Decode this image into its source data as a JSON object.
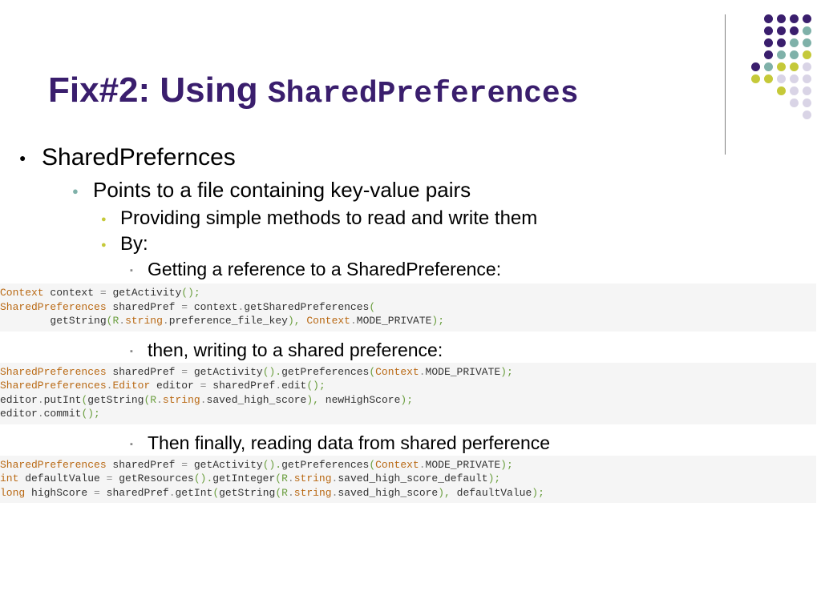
{
  "title": {
    "prefix": "Fix#2: Using ",
    "mono": "SharedPreferences"
  },
  "bullets": {
    "l1": "SharedPrefernces",
    "l2": "Points to a file containing key-value pairs",
    "l3a": "Providing simple methods to read and write them",
    "l3b": "By:",
    "l4a": "Getting a reference to a SharedPreference:",
    "l4b": "then, writing to a shared preference:",
    "l4c": "Then finally, reading data from shared perference"
  },
  "code": {
    "block1": {
      "line1": {
        "t1": "Context",
        "t2": " context ",
        "t3": "=",
        "t4": " getActivity",
        "t5": "();"
      },
      "line2": {
        "t1": "SharedPreferences",
        "t2": " sharedPref ",
        "t3": "=",
        "t4": " context",
        "t5": ".",
        "t6": "getSharedPreferences",
        "t7": "("
      },
      "line3": {
        "pad": "        ",
        "t1": "getString",
        "t2": "(",
        "t3": "R",
        "t4": ".",
        "t5": "string",
        "t6": ".",
        "t7": "preference_file_key",
        "t8": "),",
        "t9": " ",
        "t10": "Context",
        "t11": ".",
        "t12": "MODE_PRIVATE",
        "t13": ");"
      }
    },
    "block2": {
      "line1": {
        "t1": "SharedPreferences",
        "t2": " sharedPref ",
        "t3": "=",
        "t4": " getActivity",
        "t5": "().",
        "t6": "getPreferences",
        "t7": "(",
        "t8": "Context",
        "t9": ".",
        "t10": "MODE_PRIVATE",
        "t11": ");"
      },
      "line2": {
        "t1": "SharedPreferences",
        "t2": ".",
        "t3": "Editor",
        "t4": " editor ",
        "t5": "=",
        "t6": " sharedPref",
        "t7": ".",
        "t8": "edit",
        "t9": "();"
      },
      "line3": {
        "t1": "editor",
        "t2": ".",
        "t3": "putInt",
        "t4": "(",
        "t5": "getString",
        "t6": "(",
        "t7": "R",
        "t8": ".",
        "t9": "string",
        "t10": ".",
        "t11": "saved_high_score",
        "t12": "),",
        "t13": " newHighScore",
        "t14": ");"
      },
      "line4": {
        "t1": "editor",
        "t2": ".",
        "t3": "commit",
        "t4": "();"
      }
    },
    "block3": {
      "line1": {
        "t1": "SharedPreferences",
        "t2": " sharedPref ",
        "t3": "=",
        "t4": " getActivity",
        "t5": "().",
        "t6": "getPreferences",
        "t7": "(",
        "t8": "Context",
        "t9": ".",
        "t10": "MODE_PRIVATE",
        "t11": ");"
      },
      "line2": {
        "t1": "int",
        "t2": " defaultValue ",
        "t3": "=",
        "t4": " getResources",
        "t5": "().",
        "t6": "getInteger",
        "t7": "(",
        "t8": "R",
        "t9": ".",
        "t10": "string",
        "t11": ".",
        "t12": "saved_high_score_default",
        "t13": ");"
      },
      "line3": {
        "t1": "long",
        "t2": " highScore ",
        "t3": "=",
        "t4": " sharedPref",
        "t5": ".",
        "t6": "getInt",
        "t7": "(",
        "t8": "getString",
        "t9": "(",
        "t10": "R",
        "t11": ".",
        "t12": "string",
        "t13": ".",
        "t14": "saved_high_score",
        "t15": "),",
        "t16": " defaultValue",
        "t17": ");"
      }
    }
  }
}
